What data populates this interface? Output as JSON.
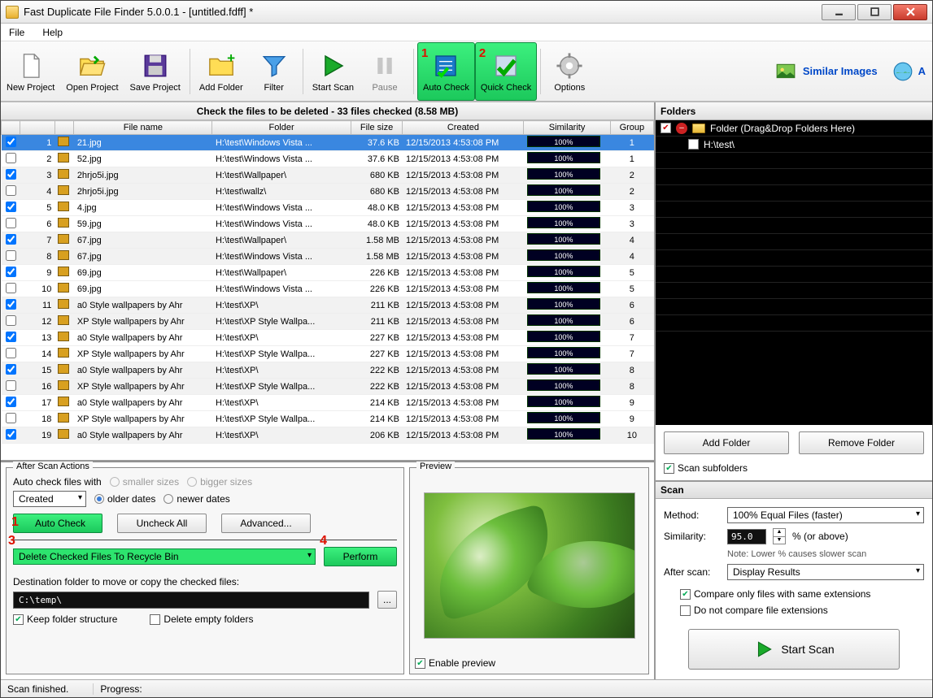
{
  "window": {
    "title": "Fast Duplicate File Finder 5.0.0.1 - [untitled.fdff] *"
  },
  "menu": {
    "file": "File",
    "help": "Help"
  },
  "toolbar": {
    "new_project": "New Project",
    "open_project": "Open Project",
    "save_project": "Save Project",
    "add_folder": "Add Folder",
    "filter": "Filter",
    "start_scan": "Start Scan",
    "pause": "Pause",
    "auto_check": "Auto Check",
    "quick_check": "Quick Check",
    "options": "Options",
    "similar_images": "Similar Images",
    "more": "A"
  },
  "instruction": "Check the files to be deleted - 33 files checked (8.58 MB)",
  "columns": {
    "check": "",
    "num": "",
    "thumb": "",
    "filename": "File name",
    "folder": "Folder",
    "filesize": "File size",
    "created": "Created",
    "similarity": "Similarity",
    "group": "Group"
  },
  "rows": [
    {
      "chk": true,
      "n": 1,
      "name": "21.jpg",
      "folder": "H:\\test\\Windows Vista ...",
      "size": "37.6 KB",
      "created": "12/15/2013 4:53:08 PM",
      "sim": "100%",
      "grp": 1,
      "sel": true
    },
    {
      "chk": false,
      "n": 2,
      "name": "52.jpg",
      "folder": "H:\\test\\Windows Vista ...",
      "size": "37.6 KB",
      "created": "12/15/2013 4:53:08 PM",
      "sim": "100%",
      "grp": 1
    },
    {
      "chk": true,
      "n": 3,
      "name": "2hrjo5i.jpg",
      "folder": "H:\\test\\Wallpaper\\",
      "size": "680 KB",
      "created": "12/15/2013 4:53:08 PM",
      "sim": "100%",
      "grp": 2
    },
    {
      "chk": false,
      "n": 4,
      "name": "2hrjo5i.jpg",
      "folder": "H:\\test\\wallz\\",
      "size": "680 KB",
      "created": "12/15/2013 4:53:08 PM",
      "sim": "100%",
      "grp": 2
    },
    {
      "chk": true,
      "n": 5,
      "name": "4.jpg",
      "folder": "H:\\test\\Windows Vista ...",
      "size": "48.0 KB",
      "created": "12/15/2013 4:53:08 PM",
      "sim": "100%",
      "grp": 3
    },
    {
      "chk": false,
      "n": 6,
      "name": "59.jpg",
      "folder": "H:\\test\\Windows Vista ...",
      "size": "48.0 KB",
      "created": "12/15/2013 4:53:08 PM",
      "sim": "100%",
      "grp": 3
    },
    {
      "chk": true,
      "n": 7,
      "name": "67.jpg",
      "folder": "H:\\test\\Wallpaper\\",
      "size": "1.58 MB",
      "created": "12/15/2013 4:53:08 PM",
      "sim": "100%",
      "grp": 4
    },
    {
      "chk": false,
      "n": 8,
      "name": "67.jpg",
      "folder": "H:\\test\\Windows Vista ...",
      "size": "1.58 MB",
      "created": "12/15/2013 4:53:08 PM",
      "sim": "100%",
      "grp": 4
    },
    {
      "chk": true,
      "n": 9,
      "name": "69.jpg",
      "folder": "H:\\test\\Wallpaper\\",
      "size": "226 KB",
      "created": "12/15/2013 4:53:08 PM",
      "sim": "100%",
      "grp": 5
    },
    {
      "chk": false,
      "n": 10,
      "name": "69.jpg",
      "folder": "H:\\test\\Windows Vista ...",
      "size": "226 KB",
      "created": "12/15/2013 4:53:08 PM",
      "sim": "100%",
      "grp": 5
    },
    {
      "chk": true,
      "n": 11,
      "name": "a0 Style wallpapers by Ahr",
      "folder": "H:\\test\\XP\\",
      "size": "211 KB",
      "created": "12/15/2013 4:53:08 PM",
      "sim": "100%",
      "grp": 6
    },
    {
      "chk": false,
      "n": 12,
      "name": "XP Style wallpapers by Ahr",
      "folder": "H:\\test\\XP Style Wallpa...",
      "size": "211 KB",
      "created": "12/15/2013 4:53:08 PM",
      "sim": "100%",
      "grp": 6
    },
    {
      "chk": true,
      "n": 13,
      "name": "a0 Style wallpapers by Ahr",
      "folder": "H:\\test\\XP\\",
      "size": "227 KB",
      "created": "12/15/2013 4:53:08 PM",
      "sim": "100%",
      "grp": 7
    },
    {
      "chk": false,
      "n": 14,
      "name": "XP Style wallpapers by Ahr",
      "folder": "H:\\test\\XP Style Wallpa...",
      "size": "227 KB",
      "created": "12/15/2013 4:53:08 PM",
      "sim": "100%",
      "grp": 7
    },
    {
      "chk": true,
      "n": 15,
      "name": "a0 Style wallpapers by Ahr",
      "folder": "H:\\test\\XP\\",
      "size": "222 KB",
      "created": "12/15/2013 4:53:08 PM",
      "sim": "100%",
      "grp": 8
    },
    {
      "chk": false,
      "n": 16,
      "name": "XP Style wallpapers by Ahr",
      "folder": "H:\\test\\XP Style Wallpa...",
      "size": "222 KB",
      "created": "12/15/2013 4:53:08 PM",
      "sim": "100%",
      "grp": 8
    },
    {
      "chk": true,
      "n": 17,
      "name": "a0 Style wallpapers by Ahr",
      "folder": "H:\\test\\XP\\",
      "size": "214 KB",
      "created": "12/15/2013 4:53:08 PM",
      "sim": "100%",
      "grp": 9
    },
    {
      "chk": false,
      "n": 18,
      "name": "XP Style wallpapers by Ahr",
      "folder": "H:\\test\\XP Style Wallpa...",
      "size": "214 KB",
      "created": "12/15/2013 4:53:08 PM",
      "sim": "100%",
      "grp": 9
    },
    {
      "chk": true,
      "n": 19,
      "name": "a0 Style wallpapers by Ahr",
      "folder": "H:\\test\\XP\\",
      "size": "206 KB",
      "created": "12/15/2013 4:53:08 PM",
      "sim": "100%",
      "grp": 10
    }
  ],
  "afterscan": {
    "title": "After Scan Actions",
    "label_check_with": "Auto check files with",
    "smaller": "smaller sizes",
    "bigger": "bigger sizes",
    "older": "older dates",
    "newer": "newer dates",
    "sort_by": "Created",
    "auto_check": "Auto Check",
    "uncheck_all": "Uncheck All",
    "advanced": "Advanced...",
    "action": "Delete Checked Files To Recycle Bin",
    "perform": "Perform",
    "dest_label": "Destination folder to move or copy the checked files:",
    "dest_value": "C:\\temp\\",
    "keep_structure": "Keep folder structure",
    "delete_empty": "Delete empty folders"
  },
  "preview": {
    "title": "Preview",
    "enable": "Enable preview"
  },
  "folders": {
    "title": "Folders",
    "root": "Folder (Drag&Drop Folders Here)",
    "items": [
      {
        "path": "H:\\test\\"
      }
    ],
    "add": "Add Folder",
    "remove": "Remove Folder",
    "scan_sub": "Scan subfolders"
  },
  "scan": {
    "title": "Scan",
    "method_label": "Method:",
    "method": "100% Equal Files (faster)",
    "sim_label": "Similarity:",
    "sim_value": "95.0",
    "sim_suffix": "%  (or above)",
    "note": "Note: Lower % causes slower scan",
    "after_label": "After scan:",
    "after": "Display Results",
    "opt_same_ext": "Compare only files with same extensions",
    "opt_no_ext": "Do not compare file extensions",
    "start": "Start Scan"
  },
  "status": {
    "msg": "Scan finished.",
    "progress": "Progress:"
  },
  "anno": {
    "a1": "1",
    "a2": "2",
    "b1": "1",
    "b3": "3",
    "b4": "4"
  }
}
